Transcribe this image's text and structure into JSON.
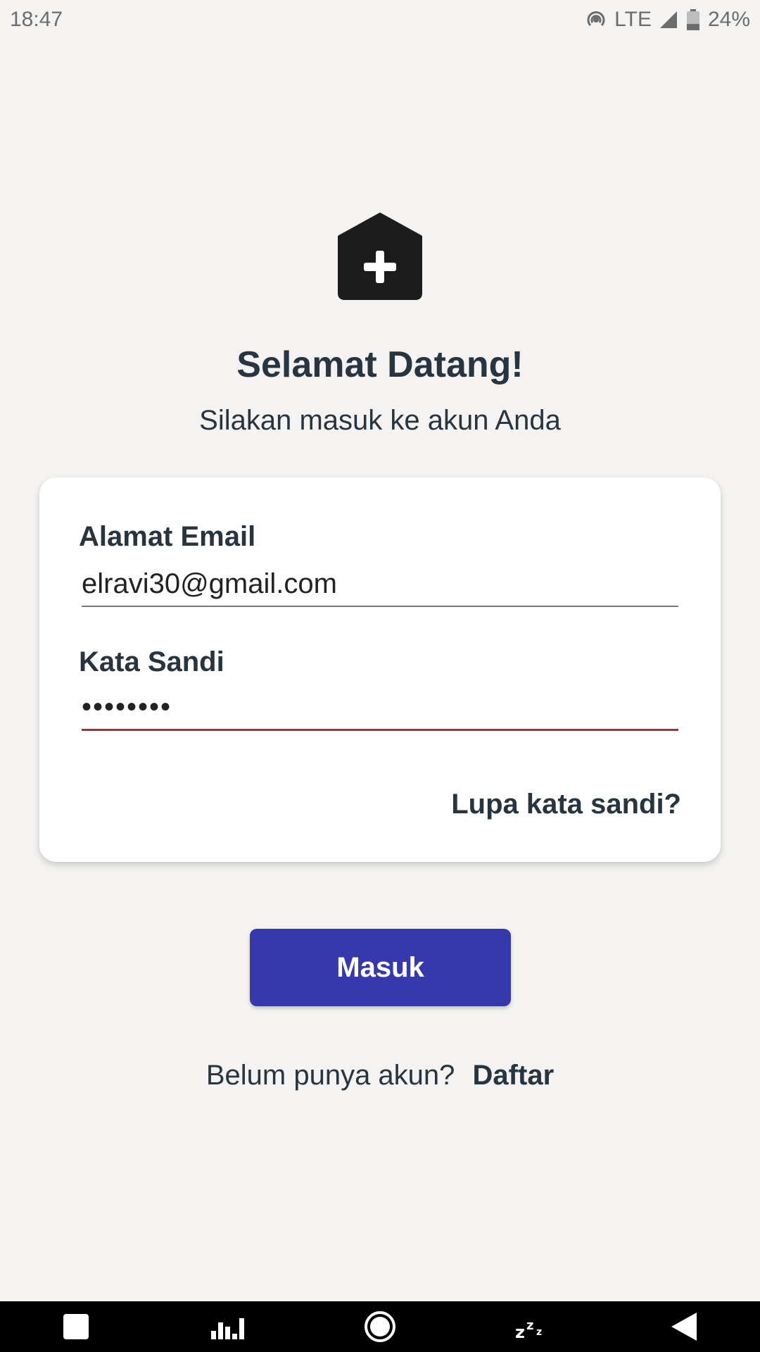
{
  "status_bar": {
    "time": "18:47",
    "network": "LTE",
    "battery": "24%"
  },
  "logo": {
    "icon": "house-plus-icon"
  },
  "header": {
    "title": "Selamat Datang!",
    "subtitle": "Silakan masuk ke akun Anda"
  },
  "form": {
    "email_label": "Alamat Email",
    "email_value": "elravi30@gmail.com",
    "password_label": "Kata Sandi",
    "password_value": "••••••••",
    "forgot_label": "Lupa kata sandi?"
  },
  "login_button": {
    "label": "Masuk"
  },
  "signup": {
    "prompt": "Belum punya akun?",
    "link": "Daftar"
  },
  "colors": {
    "background": "#f4f3f1",
    "primary": "#3639ae",
    "text": "#263540",
    "error_underline": "#b02a44"
  },
  "nav_bar": {
    "buttons": [
      "square-icon",
      "bar-chart-icon",
      "circle-home-icon",
      "sleep-icon",
      "back-triangle-icon"
    ]
  }
}
